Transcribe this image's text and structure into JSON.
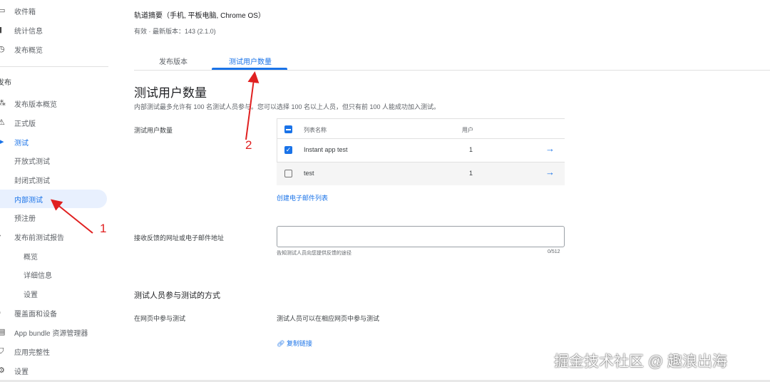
{
  "sidebar": {
    "items": [
      {
        "label": "收件箱",
        "icon": "inbox-icon"
      },
      {
        "label": "统计信息",
        "icon": "bar-chart-icon"
      },
      {
        "label": "发布概览",
        "icon": "clock-icon"
      }
    ],
    "section_label": "发布",
    "release_items": [
      {
        "label": "发布版本概览",
        "icon": "releases-icon"
      },
      {
        "label": "正式版",
        "icon": "production-icon"
      },
      {
        "label": "测试",
        "icon": "play-icon"
      },
      {
        "label": "开放式测试"
      },
      {
        "label": "封闭式测试"
      },
      {
        "label": "内部测试"
      },
      {
        "label": "预注册"
      },
      {
        "label": "发布前测试报告",
        "icon": "caret-down-icon"
      },
      {
        "label": "概览"
      },
      {
        "label": "详细信息"
      },
      {
        "label": "设置"
      },
      {
        "label": "覆盖面和设备",
        "icon": "devices-icon"
      },
      {
        "label": "App bundle 资源管理器",
        "icon": "bundle-icon"
      },
      {
        "label": "应用完整性",
        "icon": "shield-icon"
      },
      {
        "label": "设置",
        "icon": "gear-icon"
      }
    ]
  },
  "header": {
    "title": "轨道摘要（手机, 平板电脑, Chrome OS）",
    "status": "有效",
    "dot": "·",
    "version": "最新版本：143 (2.1.0)"
  },
  "tabs": [
    {
      "label": "发布版本"
    },
    {
      "label": "测试用户数量"
    }
  ],
  "main": {
    "heading": "测试用户数量",
    "description": "内部测试最多允许有 100 名测试人员参与。您可以选择 100 名以上人员，但只有前 100 人能成功加入测试。",
    "testers_label": "测试用户数量",
    "table": {
      "headers": [
        "列表名称",
        "用户"
      ],
      "rows": [
        {
          "name": "Instant app test",
          "users": "1",
          "checked": true
        },
        {
          "name": "test",
          "users": "1",
          "checked": false
        }
      ]
    },
    "create_list_link": "创建电子邮件列表",
    "feedback_label": "接收反馈的网址或电子邮件地址",
    "feedback_value": "",
    "feedback_hint": "告知测试人员向您提供反馈的途径",
    "feedback_counter": "0/512",
    "join_heading": "测试人员参与测试的方式",
    "join_web_label": "在网页中参与测试",
    "join_web_text": "测试人员可以在相应网页中参与测试",
    "copy_link": "复制链接"
  },
  "annotations": {
    "one": "1",
    "two": "2"
  },
  "watermark": "掘金技术社区 @ 趣浪出海",
  "colors": {
    "accent": "#1a73e8",
    "annotation": "#e02020"
  }
}
